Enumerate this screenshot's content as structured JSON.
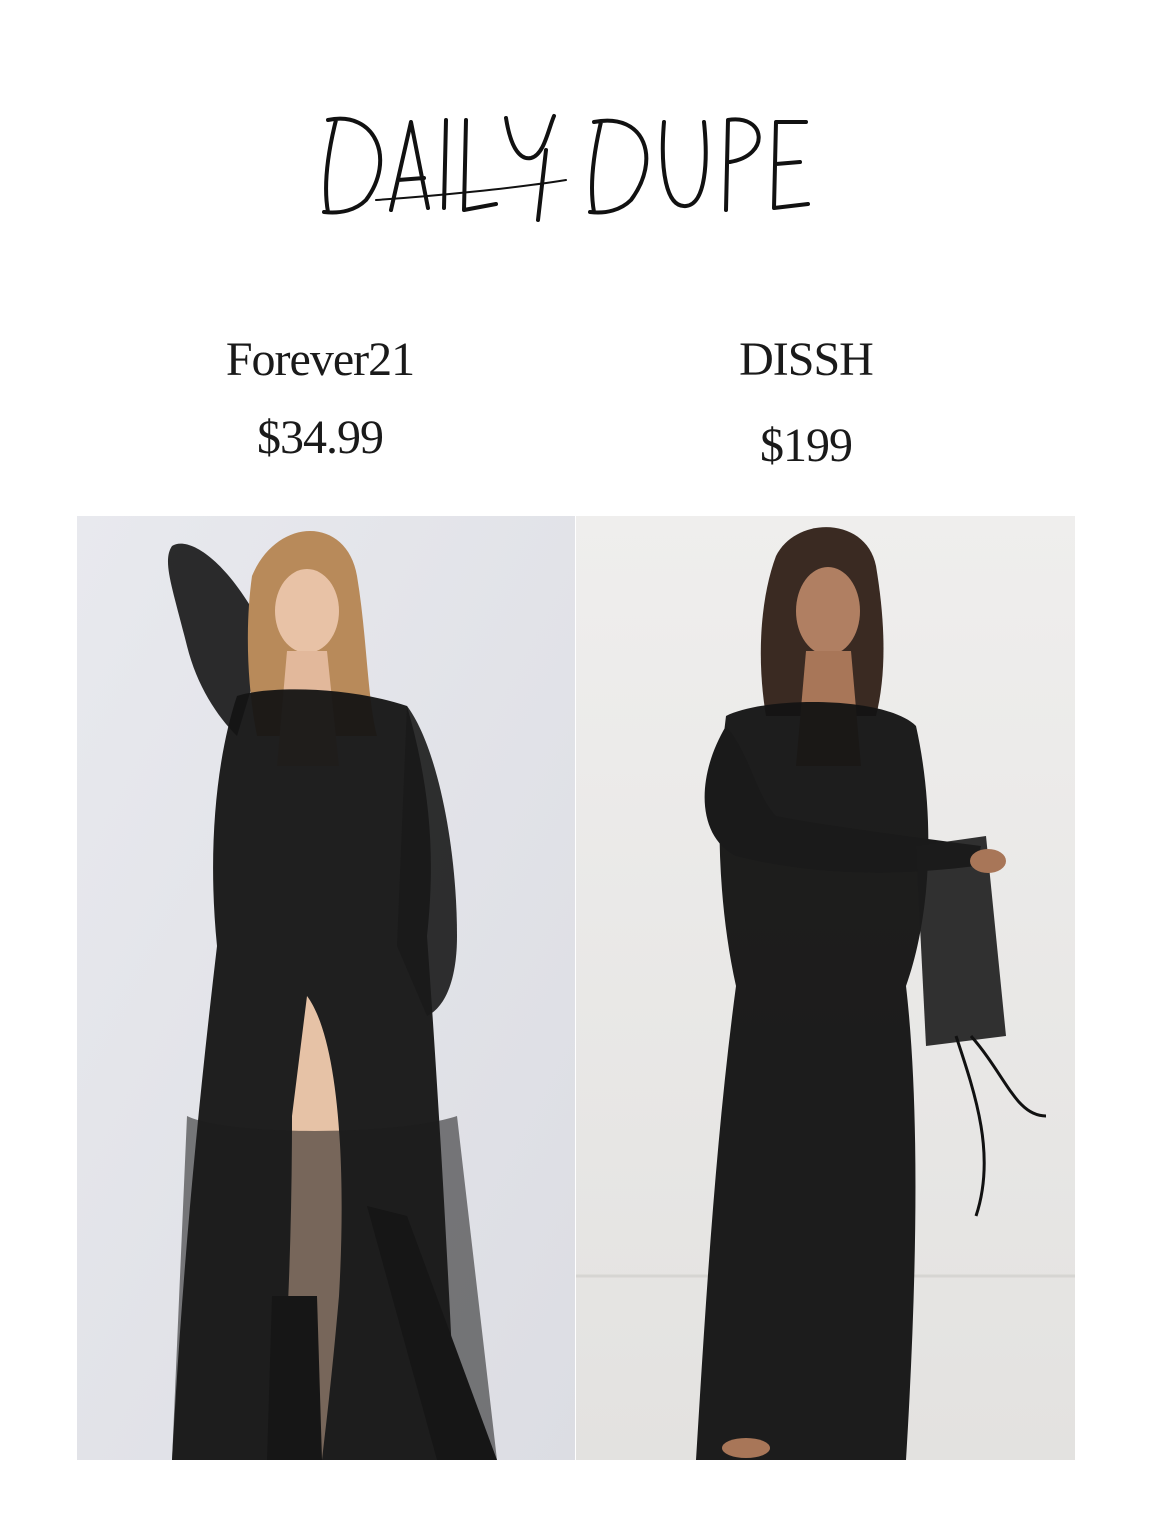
{
  "title": "DAILY DUPE",
  "products": [
    {
      "brand": "Forever21",
      "price": "$34.99"
    },
    {
      "brand": "DISSH",
      "price": "$199"
    }
  ],
  "colors": {
    "background": "#ffffff",
    "text": "#1a1a1a",
    "dress": "#141414",
    "left_backdrop": "#e4e5ea",
    "right_backdrop": "#ecebea"
  }
}
